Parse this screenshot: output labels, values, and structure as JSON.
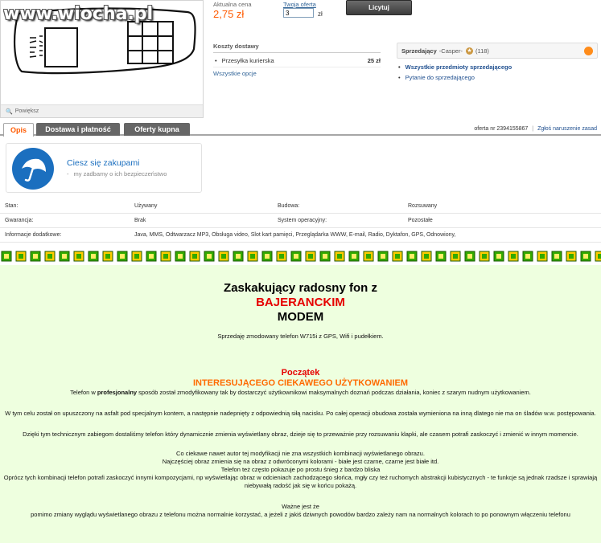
{
  "watermark": "www.wiocha.pl",
  "image": {
    "zoom_label": "Powiększ"
  },
  "price": {
    "label": "Aktualna cena",
    "value": "2,75 zł"
  },
  "offer": {
    "label": "Twoja oferta",
    "value": "3",
    "currency": "zł"
  },
  "bid_button": "Licytuj",
  "shipping": {
    "title": "Koszty dostawy",
    "rows": [
      {
        "name": "Przesyłka kurierska",
        "amount": "25 zł"
      }
    ],
    "all_options": "Wszystkie opcje"
  },
  "seller": {
    "label": "Sprzedający",
    "name": "-Casper-",
    "rating": "(118)",
    "links": [
      "Wszystkie przedmioty sprzedającego",
      "Pytanie do sprzedającego"
    ]
  },
  "tabs": [
    "Opis",
    "Dostawa i płatność",
    "Oferty kupna"
  ],
  "offer_meta": {
    "number": "oferta nr 2394155867",
    "report": "Zgłoś naruszenie zasad"
  },
  "safety": {
    "title": "Ciesz się zakupami",
    "subtitle": "my zadbamy o ich bezpieczeństwo"
  },
  "params": {
    "row1": {
      "l1": "Stan:",
      "v1": "Używany",
      "l2": "Budowa:",
      "v2": "Rozsuwany"
    },
    "row2": {
      "l1": "Gwarancja:",
      "v1": "Brak",
      "l2": "System operacyjny:",
      "v2": "Pozostałe"
    },
    "row3": {
      "l1": "Informacje dodatkowe:",
      "v1": "Java, MMS, Odtwarzacz MP3, Obsługa video, Slot kart pamięci, Przeglądarka WWW, E-mail, Radio, Dyktafon, GPS, Odnowiony,"
    }
  },
  "description": {
    "title1": "Zaskakujący radosny fon z",
    "title2": "BAJERANCKIM",
    "title3": "MODEM",
    "intro": "Sprzedaję zmodowany telefon W715i z GPS, Wifi i pudełkiem.",
    "sec_title1": "Początek",
    "sec_title2": "INTERESUJĄCEGO CIEKAWEGO UŻYTKOWANIEM",
    "p1a": "Telefon w ",
    "p1b": "profesjonalny",
    "p1c": " sposób został zmodyfikowany tak by dostarczyć użytkownikowi maksymalnych doznań podczas działania, koniec z szarym nudnym użytkowaniem.",
    "p2": "W tym celu został on upuszczony na asfalt pod specjalnym kontem, a następnie nadepnięty z odpowiednią siłą nacisku. Po całej operacji obudowa została wymieniona na inną dlatego nie ma on śladów w.w. postępowania.",
    "p3": "Dzięki tym technicznym zabiegom dostaliśmy telefon który dynamicznie zmienia wyświetlany obraz, dzieje się to przeważnie przy rozsuwaniu klapki, ale czasem potrafi zaskoczyć i zmienić w innym momencie.",
    "p4a": "Co ciekawe nawet autor tej modyfikacji nie zna wszystkich kombinacji wyświetlanego obrazu.",
    "p4b": "Najczęściej obraz zmienia się na obraz z odwróconymi kolorami - białe jest czarne, czarne jest białe itd.",
    "p4c": "Telefon też często pokazuje po prostu śnieg z bardzo bliska",
    "p4d": "Oprócz tych kombinacji telefon potrafi zaskoczyć innymi kompozycjami, np wyświetlając obraz w odcieniach zachodzącego słońca, mgły czy też ruchomych abstrakcji kubistycznych - te funkcje są jednak rzadsze i sprawiają niebywałą radość jak się w końcu pokażą.",
    "p5a": "Ważne jest że",
    "p5b": "pomimo zmiany wyglądu wyświetlanego obrazu z telefonu można normalnie korzystać, a jeżeli z jakiś dziwnych powodów bardzo zależy nam na normalnych kolorach to po ponownym włączeniu telefonu"
  }
}
